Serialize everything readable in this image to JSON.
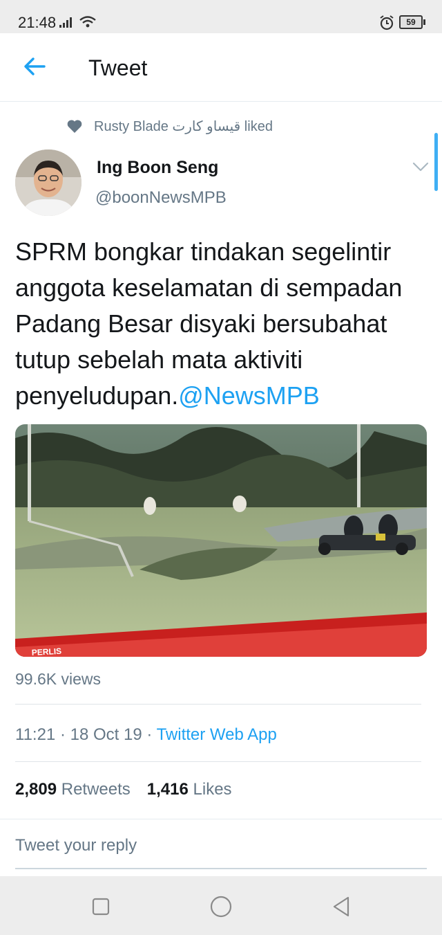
{
  "status_bar": {
    "time": "21:48",
    "battery": "59",
    "icons": [
      "signal-icon",
      "wifi-icon",
      "alarm-icon",
      "battery-icon"
    ]
  },
  "header": {
    "title": "Tweet",
    "back_icon": "arrow-left-icon"
  },
  "social_context": {
    "text": "Rusty Blade قيساو كارت liked",
    "icon": "heart-icon"
  },
  "tweet": {
    "author_name": "Ing Boon Seng",
    "author_handle": "@boonNewsMPB",
    "text": "SPRM bongkar tindakan segelintir anggota keselamatan di sempadan Padang Besar disyaki bersubahat tutup sebelah mata aktiviti penyeludupan.",
    "mention": "@NewsMPB",
    "media_caption": "PERLIS",
    "views": "99.6K views",
    "timestamp": "11:21 · 18 Oct 19 · ",
    "source_app": "Twitter Web App",
    "retweets_count": "2,809",
    "retweets_label": "Retweets",
    "likes_count": "1,416",
    "likes_label": "Likes"
  },
  "reply": {
    "placeholder": "Tweet your reply"
  },
  "colors": {
    "accent": "#1da1f2",
    "secondary_text": "#657786",
    "primary_text": "#14171a"
  }
}
